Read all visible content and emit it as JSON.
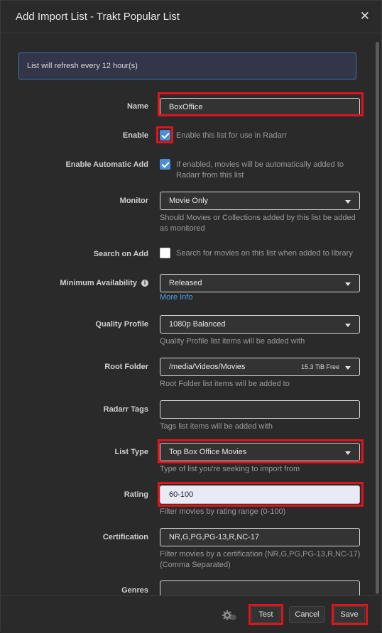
{
  "modal": {
    "title": "Add Import List - Trakt Popular List",
    "close_glyph": "✕"
  },
  "info_message": "List will refresh every 12 hour(s)",
  "fields": {
    "name": {
      "label": "Name",
      "value": "BoxOffice"
    },
    "enable": {
      "label": "Enable",
      "checked": true,
      "text": "Enable this list for use in Radarr"
    },
    "enable_auto_add": {
      "label": "Enable Automatic Add",
      "checked": true,
      "text": "If enabled, movies will be automatically added to Radarr from this list"
    },
    "monitor": {
      "label": "Monitor",
      "value": "Movie Only",
      "help": "Should Movies or Collections added by this list be added as monitored"
    },
    "search_on_add": {
      "label": "Search on Add",
      "checked": false,
      "text": "Search for movies on this list when added to library"
    },
    "minimum_availability": {
      "label": "Minimum Availability",
      "value": "Released",
      "link": "More Info",
      "info_icon": "i"
    },
    "quality_profile": {
      "label": "Quality Profile",
      "value": "1080p Balanced",
      "help": "Quality Profile list items will be added with"
    },
    "root_folder": {
      "label": "Root Folder",
      "value": "/media/Videos/Movies",
      "free_space": "15.3 TiB Free",
      "help": "Root Folder list items will be added to"
    },
    "radarr_tags": {
      "label": "Radarr Tags",
      "value": "",
      "help": "Tags list items will be added with"
    },
    "list_type": {
      "label": "List Type",
      "value": "Top Box Office Movies",
      "help": "Type of list you're seeking to import from"
    },
    "rating": {
      "label": "Rating",
      "value": "60-100",
      "help": "Filter movies by rating range (0-100)"
    },
    "certification": {
      "label": "Certification",
      "value": "NR,G,PG,PG-13,R,NC-17",
      "help": "Filter movies by a certification (NR,G,PG,PG-13,R,NC-17) (Comma Separated)"
    },
    "genres": {
      "label": "Genres",
      "value": ""
    }
  },
  "footer": {
    "test_label": "Test",
    "cancel_label": "Cancel",
    "save_label": "Save",
    "settings_icon": "gear-icon"
  },
  "colors": {
    "highlight": "#e0141c",
    "accent": "#4a8fd6",
    "link": "#4aa3f0"
  }
}
